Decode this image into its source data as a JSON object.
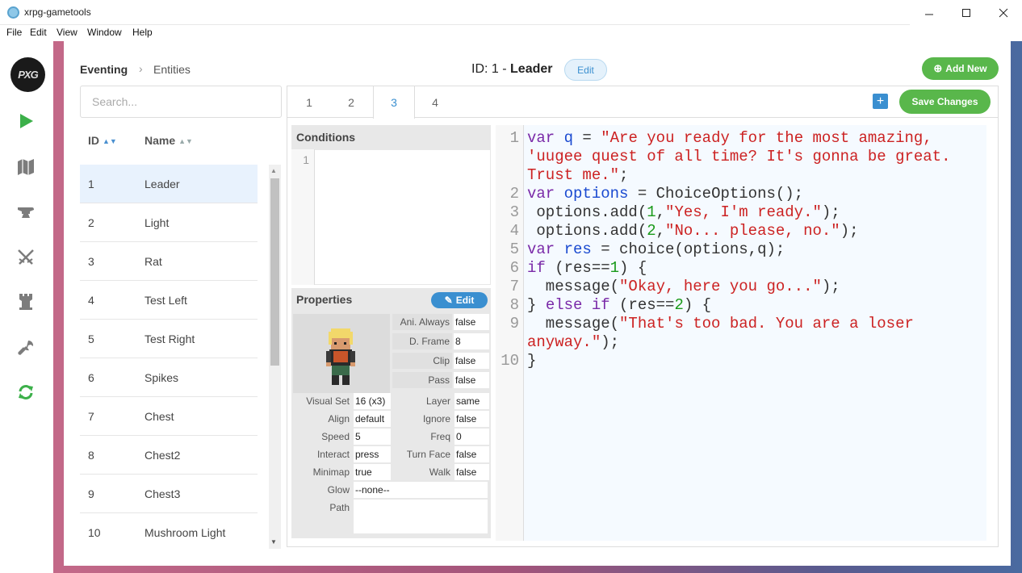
{
  "window": {
    "title": "xrpg-gametools",
    "minimize": "—",
    "maximize": "☐",
    "close": "✕"
  },
  "menu": [
    "File",
    "Edit",
    "View",
    "Window",
    "Help"
  ],
  "sidebar": {
    "logo_text": "PXG",
    "icons": [
      "play-icon",
      "map-icon",
      "anvil-icon",
      "swords-icon",
      "tower-icon",
      "wrench-icon",
      "sync-icon"
    ]
  },
  "breadcrumb": {
    "section": "Eventing",
    "page": "Entities",
    "separator": "›"
  },
  "header": {
    "id_prefix": "ID: 1 - ",
    "name": "Leader",
    "edit_label": "Edit",
    "add_new_label": "Add New",
    "add_new_glyph": "⊕"
  },
  "search": {
    "placeholder": "Search..."
  },
  "table": {
    "col_id": "ID",
    "col_name": "Name",
    "rows": [
      {
        "id": "1",
        "name": "Leader"
      },
      {
        "id": "2",
        "name": "Light"
      },
      {
        "id": "3",
        "name": "Rat"
      },
      {
        "id": "4",
        "name": "Test Left"
      },
      {
        "id": "5",
        "name": "Test Right"
      },
      {
        "id": "6",
        "name": "Spikes"
      },
      {
        "id": "7",
        "name": "Chest"
      },
      {
        "id": "8",
        "name": "Chest2"
      },
      {
        "id": "9",
        "name": "Chest3"
      },
      {
        "id": "10",
        "name": "Mushroom Light"
      }
    ],
    "selected_row": 0
  },
  "tabs": [
    "1",
    "2",
    "3",
    "4"
  ],
  "active_tab": 2,
  "toolbar": {
    "plus_label": "+",
    "save_label": "Save Changes"
  },
  "conditions": {
    "title": "Conditions",
    "line_numbers": [
      "1"
    ]
  },
  "properties": {
    "title": "Properties",
    "edit_label": "Edit",
    "right_fields": [
      {
        "label": "Ani. Always",
        "value": "false"
      },
      {
        "label": "D. Frame",
        "value": "8"
      },
      {
        "label": "Clip",
        "value": "false"
      },
      {
        "label": "Pass",
        "value": "false"
      }
    ],
    "grid_rows": [
      [
        {
          "label": "Visual Set",
          "value": "16 (x3)"
        },
        {
          "label": "Layer",
          "value": "same"
        }
      ],
      [
        {
          "label": "Align",
          "value": "default"
        },
        {
          "label": "Ignore",
          "value": "false"
        }
      ],
      [
        {
          "label": "Speed",
          "value": "5"
        },
        {
          "label": "Freq",
          "value": "0"
        }
      ],
      [
        {
          "label": "Interact",
          "value": "press"
        },
        {
          "label": "Turn Face",
          "value": "false"
        }
      ],
      [
        {
          "label": "Minimap",
          "value": "true"
        },
        {
          "label": "Walk",
          "value": "false"
        }
      ]
    ],
    "glow": {
      "label": "Glow",
      "value": "--none--"
    },
    "path": {
      "label": "Path",
      "value": ""
    }
  },
  "code": {
    "line_numbers": [
      "1",
      "2",
      "3",
      "4",
      "5",
      "6",
      "7",
      "8",
      "9",
      "10"
    ]
  },
  "colors": {
    "accent_blue": "#3a8fd0",
    "accent_green": "#59b74b",
    "selected_row": "#e8f2fd"
  }
}
